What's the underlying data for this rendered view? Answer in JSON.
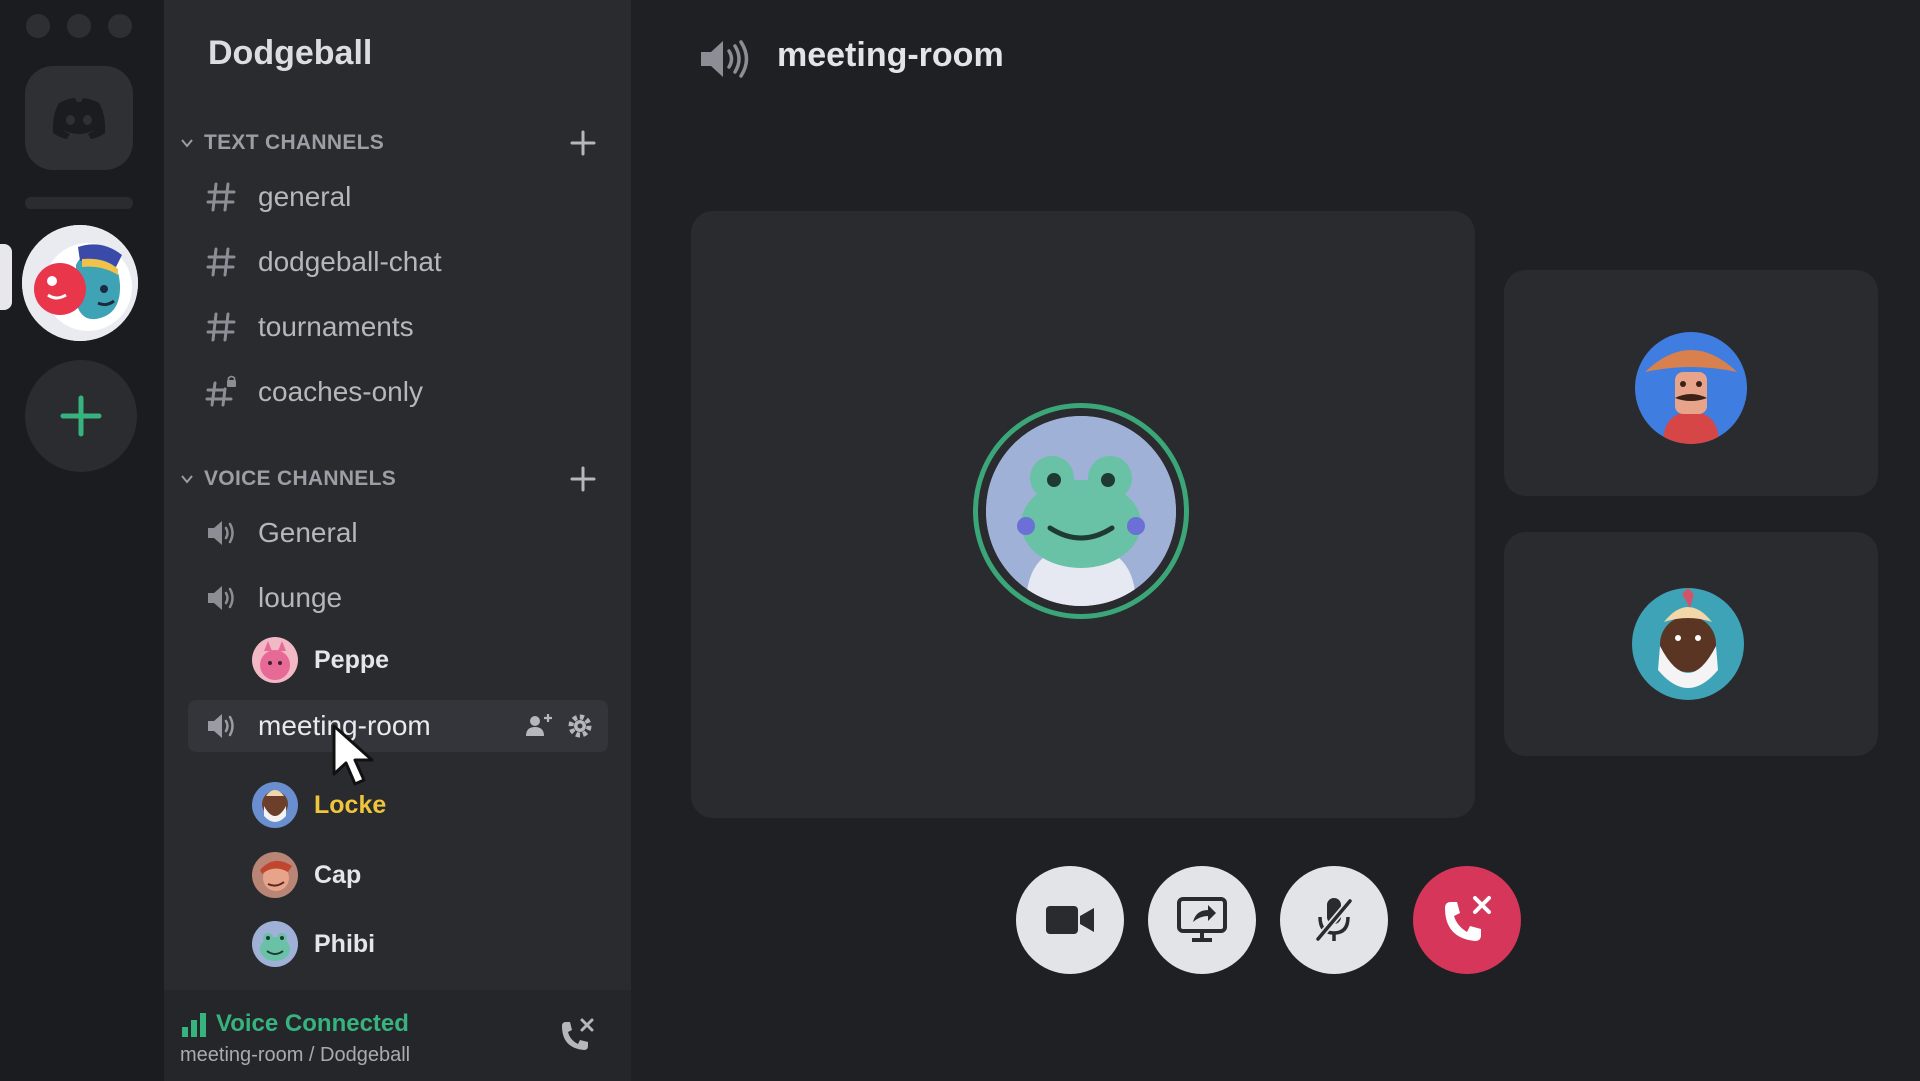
{
  "colors": {
    "accent_green": "#36b37e",
    "speaking_yellow": "#f0c53c",
    "end_call_red": "#d6365a"
  },
  "server": {
    "name": "Dodgeball"
  },
  "text_channels": {
    "label": "TEXT CHANNELS",
    "items": [
      {
        "name": "general",
        "icon": "hash-icon"
      },
      {
        "name": "dodgeball-chat",
        "icon": "hash-icon"
      },
      {
        "name": "tournaments",
        "icon": "hash-icon"
      },
      {
        "name": "coaches-only",
        "icon": "hash-lock-icon"
      }
    ]
  },
  "voice_channels": {
    "label": "VOICE CHANNELS",
    "items": [
      {
        "name": "General",
        "icon": "speaker-icon"
      },
      {
        "name": "lounge",
        "icon": "speaker-icon",
        "members": [
          "Peppe"
        ]
      },
      {
        "name": "meeting-room",
        "icon": "speaker-icon",
        "members": [
          "Locke",
          "Cap",
          "Phibi"
        ]
      }
    ]
  },
  "voice_status": {
    "status": "Voice Connected",
    "location": "meeting-room / Dodgeball"
  },
  "main": {
    "title": "meeting-room"
  }
}
